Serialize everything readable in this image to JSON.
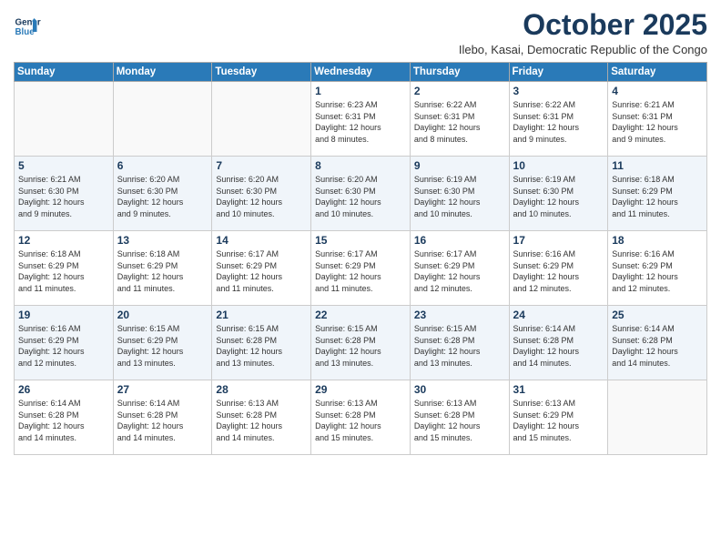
{
  "header": {
    "logo_line1": "General",
    "logo_line2": "Blue",
    "month": "October 2025",
    "location": "Ilebo, Kasai, Democratic Republic of the Congo"
  },
  "weekdays": [
    "Sunday",
    "Monday",
    "Tuesday",
    "Wednesday",
    "Thursday",
    "Friday",
    "Saturday"
  ],
  "weeks": [
    [
      {
        "day": "",
        "info": ""
      },
      {
        "day": "",
        "info": ""
      },
      {
        "day": "",
        "info": ""
      },
      {
        "day": "1",
        "info": "Sunrise: 6:23 AM\nSunset: 6:31 PM\nDaylight: 12 hours\nand 8 minutes."
      },
      {
        "day": "2",
        "info": "Sunrise: 6:22 AM\nSunset: 6:31 PM\nDaylight: 12 hours\nand 8 minutes."
      },
      {
        "day": "3",
        "info": "Sunrise: 6:22 AM\nSunset: 6:31 PM\nDaylight: 12 hours\nand 9 minutes."
      },
      {
        "day": "4",
        "info": "Sunrise: 6:21 AM\nSunset: 6:31 PM\nDaylight: 12 hours\nand 9 minutes."
      }
    ],
    [
      {
        "day": "5",
        "info": "Sunrise: 6:21 AM\nSunset: 6:30 PM\nDaylight: 12 hours\nand 9 minutes."
      },
      {
        "day": "6",
        "info": "Sunrise: 6:20 AM\nSunset: 6:30 PM\nDaylight: 12 hours\nand 9 minutes."
      },
      {
        "day": "7",
        "info": "Sunrise: 6:20 AM\nSunset: 6:30 PM\nDaylight: 12 hours\nand 10 minutes."
      },
      {
        "day": "8",
        "info": "Sunrise: 6:20 AM\nSunset: 6:30 PM\nDaylight: 12 hours\nand 10 minutes."
      },
      {
        "day": "9",
        "info": "Sunrise: 6:19 AM\nSunset: 6:30 PM\nDaylight: 12 hours\nand 10 minutes."
      },
      {
        "day": "10",
        "info": "Sunrise: 6:19 AM\nSunset: 6:30 PM\nDaylight: 12 hours\nand 10 minutes."
      },
      {
        "day": "11",
        "info": "Sunrise: 6:18 AM\nSunset: 6:29 PM\nDaylight: 12 hours\nand 11 minutes."
      }
    ],
    [
      {
        "day": "12",
        "info": "Sunrise: 6:18 AM\nSunset: 6:29 PM\nDaylight: 12 hours\nand 11 minutes."
      },
      {
        "day": "13",
        "info": "Sunrise: 6:18 AM\nSunset: 6:29 PM\nDaylight: 12 hours\nand 11 minutes."
      },
      {
        "day": "14",
        "info": "Sunrise: 6:17 AM\nSunset: 6:29 PM\nDaylight: 12 hours\nand 11 minutes."
      },
      {
        "day": "15",
        "info": "Sunrise: 6:17 AM\nSunset: 6:29 PM\nDaylight: 12 hours\nand 11 minutes."
      },
      {
        "day": "16",
        "info": "Sunrise: 6:17 AM\nSunset: 6:29 PM\nDaylight: 12 hours\nand 12 minutes."
      },
      {
        "day": "17",
        "info": "Sunrise: 6:16 AM\nSunset: 6:29 PM\nDaylight: 12 hours\nand 12 minutes."
      },
      {
        "day": "18",
        "info": "Sunrise: 6:16 AM\nSunset: 6:29 PM\nDaylight: 12 hours\nand 12 minutes."
      }
    ],
    [
      {
        "day": "19",
        "info": "Sunrise: 6:16 AM\nSunset: 6:29 PM\nDaylight: 12 hours\nand 12 minutes."
      },
      {
        "day": "20",
        "info": "Sunrise: 6:15 AM\nSunset: 6:29 PM\nDaylight: 12 hours\nand 13 minutes."
      },
      {
        "day": "21",
        "info": "Sunrise: 6:15 AM\nSunset: 6:28 PM\nDaylight: 12 hours\nand 13 minutes."
      },
      {
        "day": "22",
        "info": "Sunrise: 6:15 AM\nSunset: 6:28 PM\nDaylight: 12 hours\nand 13 minutes."
      },
      {
        "day": "23",
        "info": "Sunrise: 6:15 AM\nSunset: 6:28 PM\nDaylight: 12 hours\nand 13 minutes."
      },
      {
        "day": "24",
        "info": "Sunrise: 6:14 AM\nSunset: 6:28 PM\nDaylight: 12 hours\nand 14 minutes."
      },
      {
        "day": "25",
        "info": "Sunrise: 6:14 AM\nSunset: 6:28 PM\nDaylight: 12 hours\nand 14 minutes."
      }
    ],
    [
      {
        "day": "26",
        "info": "Sunrise: 6:14 AM\nSunset: 6:28 PM\nDaylight: 12 hours\nand 14 minutes."
      },
      {
        "day": "27",
        "info": "Sunrise: 6:14 AM\nSunset: 6:28 PM\nDaylight: 12 hours\nand 14 minutes."
      },
      {
        "day": "28",
        "info": "Sunrise: 6:13 AM\nSunset: 6:28 PM\nDaylight: 12 hours\nand 14 minutes."
      },
      {
        "day": "29",
        "info": "Sunrise: 6:13 AM\nSunset: 6:28 PM\nDaylight: 12 hours\nand 15 minutes."
      },
      {
        "day": "30",
        "info": "Sunrise: 6:13 AM\nSunset: 6:28 PM\nDaylight: 12 hours\nand 15 minutes."
      },
      {
        "day": "31",
        "info": "Sunrise: 6:13 AM\nSunset: 6:29 PM\nDaylight: 12 hours\nand 15 minutes."
      },
      {
        "day": "",
        "info": ""
      }
    ]
  ]
}
